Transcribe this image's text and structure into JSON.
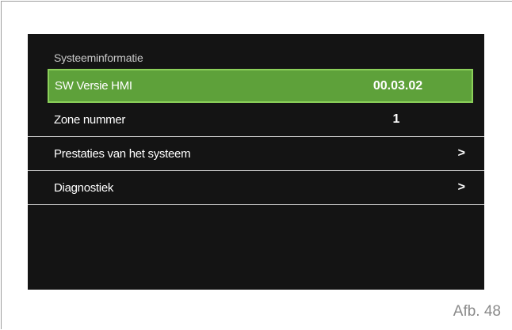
{
  "screen": {
    "title": "Systeeminformatie",
    "items": [
      {
        "label": "SW Versie HMI",
        "value": "00.03.02",
        "selected": true
      },
      {
        "label": "Zone nummer",
        "value": "1"
      },
      {
        "label": "Prestaties van het systeem",
        "chevron": ">"
      },
      {
        "label": "Diagnostiek",
        "chevron": ">"
      }
    ],
    "colors": {
      "background": "#141414",
      "selected": "#5ea13a",
      "selected_border": "#8bd05a"
    }
  },
  "caption": "Afb. 48"
}
